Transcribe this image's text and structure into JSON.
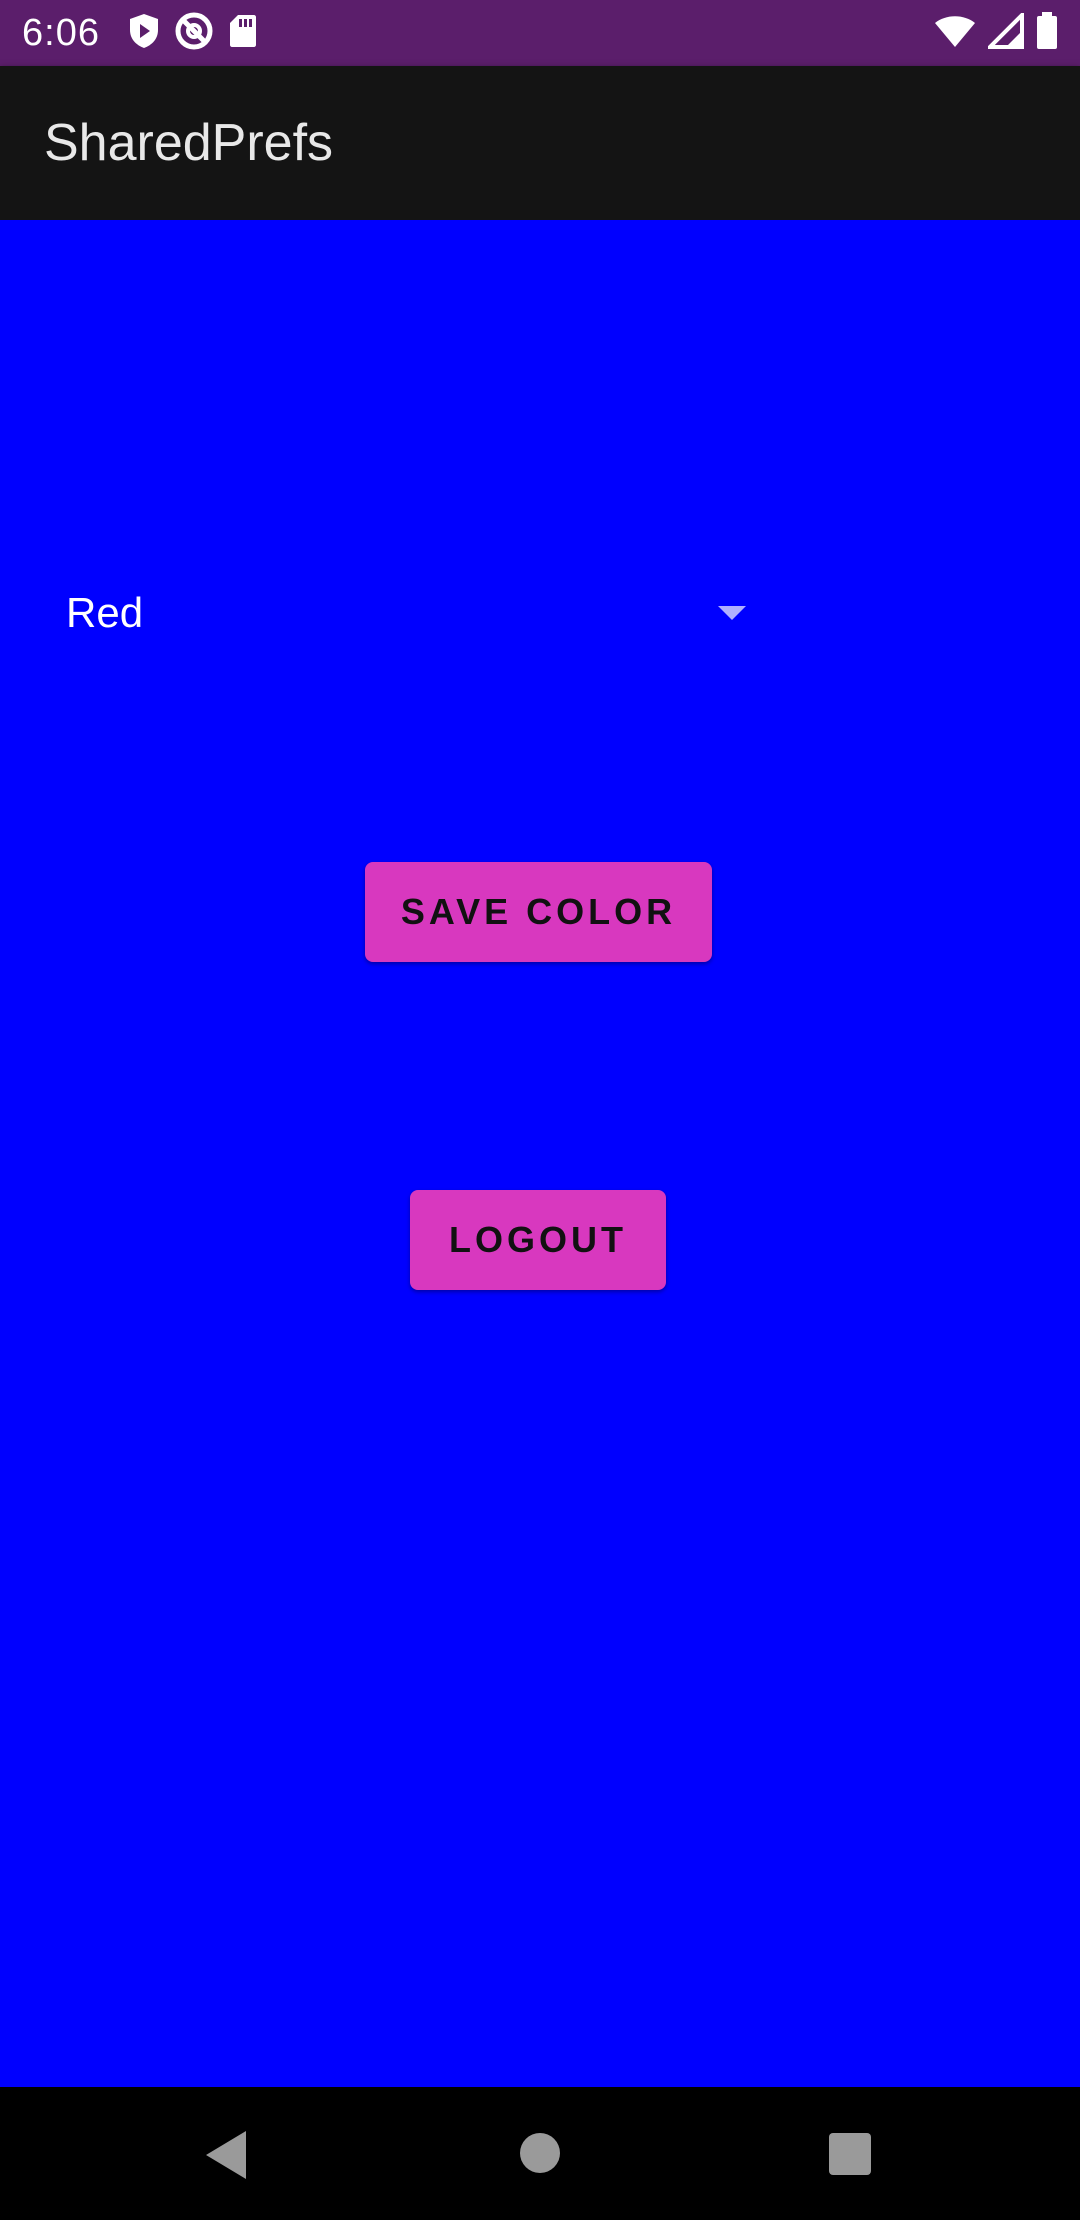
{
  "status_bar": {
    "time": "6:06",
    "icons": [
      "shield-play-icon",
      "no-sim-icon",
      "sd-card-icon",
      "wifi-icon",
      "signal-icon",
      "battery-icon"
    ],
    "background_color": "#5b1e6b"
  },
  "app_bar": {
    "title": "SharedPrefs",
    "background_color": "#141414"
  },
  "main": {
    "background_color": "#0000ff",
    "color_spinner": {
      "selected_value": "Red",
      "icon": "dropdown-arrow-icon"
    },
    "save_button_label": "SAVE COLOR",
    "logout_button_label": "LOGOUT",
    "button_color": "#d838bf"
  },
  "nav_bar": {
    "buttons": [
      "back-icon",
      "home-icon",
      "recents-icon"
    ]
  }
}
